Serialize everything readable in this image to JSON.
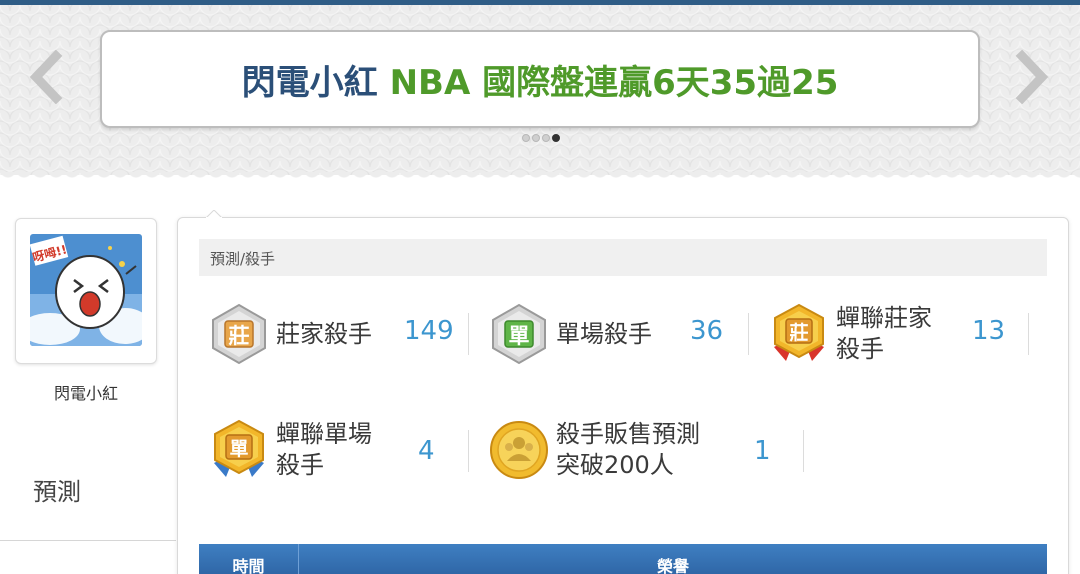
{
  "banner": {
    "user_name": "閃電小紅",
    "headline": "NBA 國際盤連贏6天35過25",
    "dots": [
      false,
      false,
      false,
      true
    ]
  },
  "profile": {
    "name": "閃電小紅",
    "avatar_text": "呀呣!!"
  },
  "sidebar": {
    "predict_label": "預測"
  },
  "panel": {
    "breadcrumb": "預測/殺手",
    "awards": [
      {
        "icon": "banker-silver-badge-icon",
        "glyph": "莊",
        "label": "莊家殺手",
        "count": "149"
      },
      {
        "icon": "single-silver-badge-icon",
        "glyph": "單",
        "label": "單場殺手",
        "count": "36"
      },
      {
        "icon": "banker-gold-medal-icon",
        "glyph": "莊",
        "label_line1": "蟬聯莊家",
        "label_line2": "殺手",
        "count": "13"
      },
      {
        "icon": "single-gold-medal-icon",
        "glyph": "單",
        "label_line1": "蟬聯單場",
        "label_line2": "殺手",
        "count": "4"
      },
      {
        "icon": "sales-gold-coin-icon",
        "label_line1": "殺手販售預測",
        "label_line2": "突破200人",
        "count": "1"
      }
    ],
    "table": {
      "headers": [
        "時間",
        "榮譽"
      ]
    }
  },
  "colors": {
    "accent_blue": "#3c96cf",
    "banner_name": "#2b4f78",
    "banner_green": "#4f9a2a",
    "table_header": "#2f6aa8"
  }
}
